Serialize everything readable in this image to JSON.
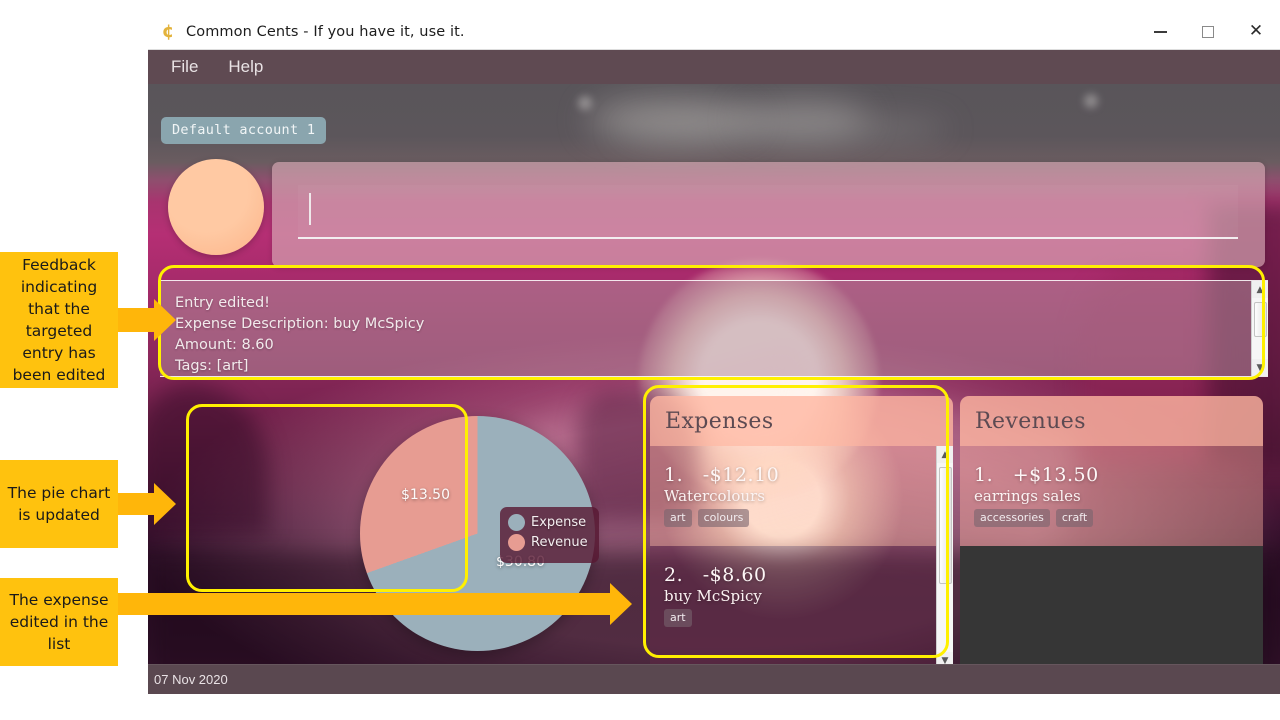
{
  "window": {
    "title": "Common Cents - If you have it, use it.",
    "app_icon": "cent-icon",
    "controls": {
      "minimize": "minimize-icon",
      "maximize": "maximize-icon",
      "close": "close-icon"
    }
  },
  "menubar": {
    "items": [
      {
        "label": "File"
      },
      {
        "label": "Help"
      }
    ]
  },
  "account": {
    "tab_label": "Default account 1"
  },
  "command": {
    "value": "",
    "placeholder": ""
  },
  "feedback": {
    "lines": [
      "Entry edited!",
      "Expense Description: buy McSpicy",
      "Amount: 8.60",
      "Tags: [art]"
    ]
  },
  "chart_data": {
    "type": "pie",
    "title": "",
    "labels": [
      "Expense",
      "Revenue"
    ],
    "values": [
      30.8,
      13.5
    ],
    "value_labels": [
      "$30.80",
      "$13.50"
    ],
    "colors": [
      "#9BB0BB",
      "#E79C92"
    ],
    "legend_position": "right",
    "total": 44.3,
    "percentages": [
      69.5,
      30.5
    ],
    "start_angle_deg": 0,
    "direction": "clockwise"
  },
  "legend": {
    "entries": [
      {
        "label": "Expense",
        "color": "#9BB0BB"
      },
      {
        "label": "Revenue",
        "color": "#E79C92"
      }
    ]
  },
  "expenses_panel": {
    "title": "Expenses",
    "entries": [
      {
        "index": "1.",
        "amount": "-$12.10",
        "description": "Watercolours",
        "tags": [
          "art",
          "colours"
        ]
      },
      {
        "index": "2.",
        "amount": "-$8.60",
        "description": "buy McSpicy",
        "tags": [
          "art"
        ]
      }
    ]
  },
  "revenues_panel": {
    "title": "Revenues",
    "entries": [
      {
        "index": "1.",
        "amount": "+$13.50",
        "description": "earrings sales",
        "tags": [
          "accessories",
          "craft"
        ]
      }
    ]
  },
  "statusbar": {
    "date": "07 Nov 2020"
  },
  "annotations": [
    {
      "id": "feedback-note",
      "text": "Feedback indicating that the targeted entry has been edited"
    },
    {
      "id": "pie-note",
      "text": "The pie chart is updated"
    },
    {
      "id": "expense-note",
      "text": "The expense edited in the list"
    }
  ],
  "colors": {
    "highlight": "#FFF000",
    "callout_bg": "#FFC20E",
    "arrow": "#FFB60A",
    "expense_slice": "#9BB0BB",
    "revenue_slice": "#E79C92",
    "account_tab": "#8AA5AE"
  }
}
